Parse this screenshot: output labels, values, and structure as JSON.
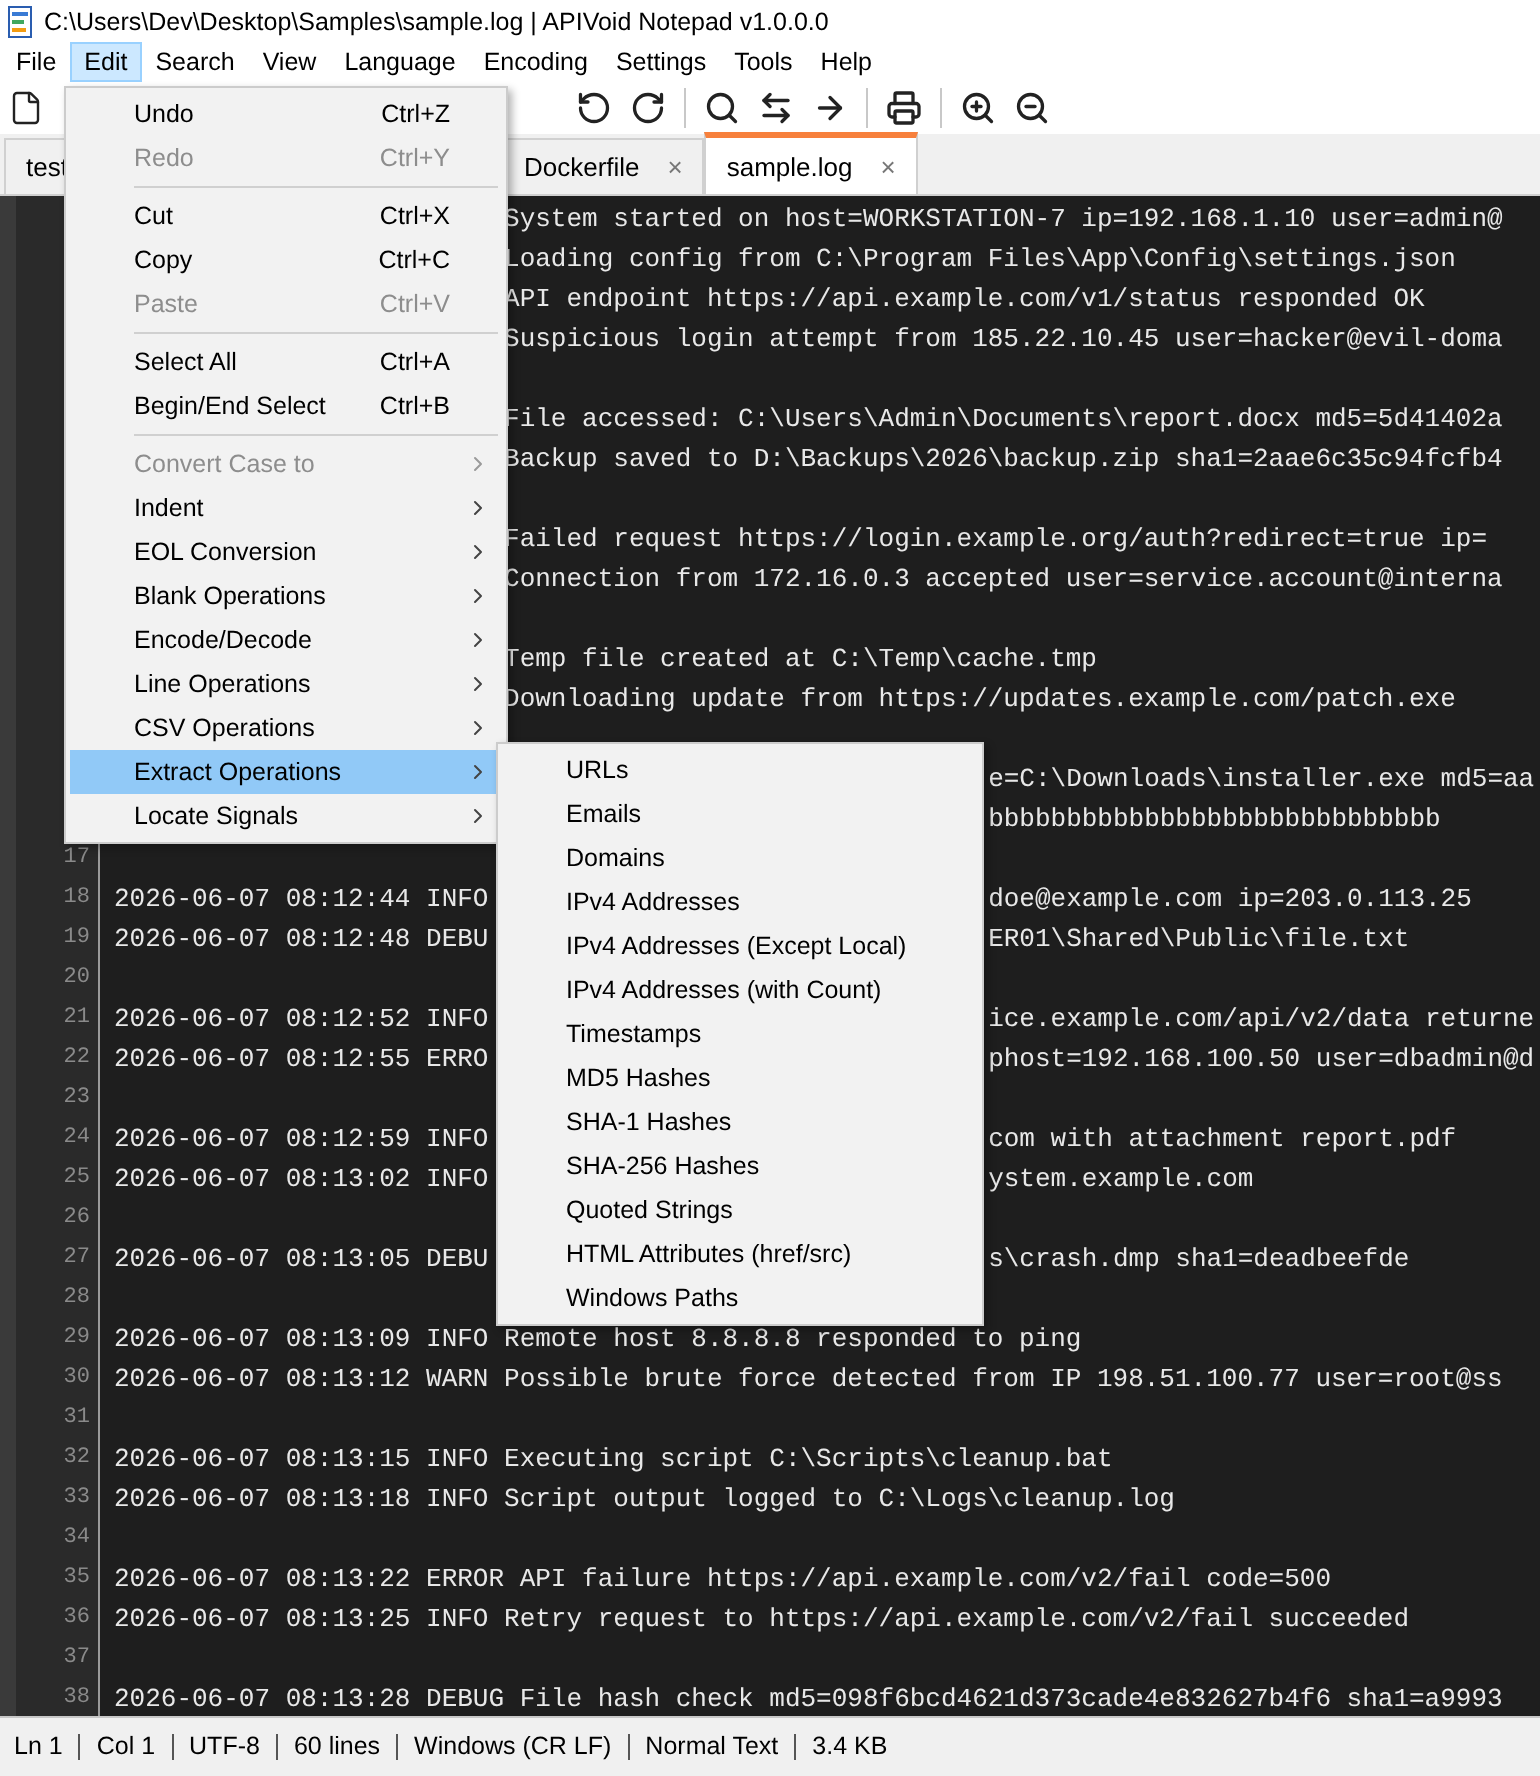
{
  "window": {
    "title": "C:\\Users\\Dev\\Desktop\\Samples\\sample.log | APIVoid Notepad v1.0.0.0"
  },
  "menubar": [
    {
      "label": "File",
      "selected": false
    },
    {
      "label": "Edit",
      "selected": true
    },
    {
      "label": "Search",
      "selected": false
    },
    {
      "label": "View",
      "selected": false
    },
    {
      "label": "Language",
      "selected": false
    },
    {
      "label": "Encoding",
      "selected": false
    },
    {
      "label": "Settings",
      "selected": false
    },
    {
      "label": "Tools",
      "selected": false
    },
    {
      "label": "Help",
      "selected": false
    }
  ],
  "tabs": [
    {
      "label": "test",
      "selected": false
    },
    {
      "label": "Dockerfile",
      "close": "×",
      "selected": false
    },
    {
      "label": "sample.log",
      "close": "×",
      "selected": true
    }
  ],
  "editor": {
    "lines": [
      {
        "kind": "under-menu",
        "tail": "System started on host=WORKSTATION-7 ip=192.168.1.10 user=admin@"
      },
      {
        "kind": "under-menu",
        "tail": "Loading config from C:\\Program Files\\App\\Config\\settings.json"
      },
      {
        "kind": "under-menu",
        "tail": "API endpoint https://api.example.com/v1/status responded OK"
      },
      {
        "kind": "under-menu",
        "tail": "Suspicious login attempt from 185.22.10.45 user=hacker@evil-doma"
      },
      {
        "kind": "under-menu"
      },
      {
        "kind": "under-menu",
        "tail": "File accessed: C:\\Users\\Admin\\Documents\\report.docx md5=5d41402a"
      },
      {
        "kind": "under-menu",
        "tail": "Backup saved to D:\\Backups\\2026\\backup.zip sha1=2aae6c35c94fcfb4"
      },
      {
        "kind": "under-menu"
      },
      {
        "kind": "under-menu",
        "tail": "Failed request https://login.example.org/auth?redirect=true ip="
      },
      {
        "kind": "under-menu",
        "tail": "Connection from 172.16.0.3 accepted user=service.account@interna"
      },
      {
        "kind": "under-menu"
      },
      {
        "kind": "under-menu",
        "tail": "Temp file created at C:\\Temp\\cache.tmp"
      },
      {
        "kind": "under-menu",
        "tail": "Downloading update from https://updates.example.com/patch.exe"
      },
      {
        "kind": "under-menu"
      },
      {
        "kind": "under-submenu",
        "tail": "e=C:\\Downloads\\installer.exe md5=aa"
      },
      {
        "kind": "under-submenu",
        "tail": "bbbbbbbbbbbbbbbbbbbbbbbbbbbbb"
      },
      {
        "kind": "plain",
        "number": "17"
      },
      {
        "kind": "under-submenu",
        "number": "18",
        "text": "2026-06-07 08:12:44 INFO",
        "tail": "doe@example.com ip=203.0.113.25"
      },
      {
        "kind": "under-submenu",
        "number": "19",
        "text": "2026-06-07 08:12:48 DEBU",
        "tail": "ER01\\Shared\\Public\\file.txt"
      },
      {
        "kind": "plain",
        "number": "20"
      },
      {
        "kind": "under-submenu",
        "number": "21",
        "text": "2026-06-07 08:12:52 INFO",
        "tail": "ice.example.com/api/v2/data returne"
      },
      {
        "kind": "under-submenu",
        "number": "22",
        "text": "2026-06-07 08:12:55 ERRO",
        "tail": "phost=192.168.100.50 user=dbadmin@d"
      },
      {
        "kind": "plain",
        "number": "23"
      },
      {
        "kind": "under-submenu",
        "number": "24",
        "text": "2026-06-07 08:12:59 INFO",
        "tail": "com with attachment report.pdf"
      },
      {
        "kind": "under-submenu",
        "number": "25",
        "text": "2026-06-07 08:13:02 INFO",
        "tail": "ystem.example.com"
      },
      {
        "kind": "plain",
        "number": "26"
      },
      {
        "kind": "under-submenu",
        "number": "27",
        "text": "2026-06-07 08:13:05 DEBU",
        "tail": "s\\crash.dmp sha1=deadbeefde"
      },
      {
        "kind": "plain",
        "number": "28"
      },
      {
        "kind": "plain",
        "number": "29",
        "text": "2026-06-07 08:13:09 INFO Remote host 8.8.8.8 responded to ping"
      },
      {
        "kind": "plain",
        "number": "30",
        "text": "2026-06-07 08:13:12 WARN Possible brute force detected from IP 198.51.100.77 user=root@ss"
      },
      {
        "kind": "plain",
        "number": "31"
      },
      {
        "kind": "plain",
        "number": "32",
        "text": "2026-06-07 08:13:15 INFO Executing script C:\\Scripts\\cleanup.bat"
      },
      {
        "kind": "plain",
        "number": "33",
        "text": "2026-06-07 08:13:18 INFO Script output logged to C:\\Logs\\cleanup.log"
      },
      {
        "kind": "plain",
        "number": "34"
      },
      {
        "kind": "plain",
        "number": "35",
        "text": "2026-06-07 08:13:22 ERROR API failure https://api.example.com/v2/fail code=500"
      },
      {
        "kind": "plain",
        "number": "36",
        "text": "2026-06-07 08:13:25 INFO Retry request to https://api.example.com/v2/fail succeeded"
      },
      {
        "kind": "plain",
        "number": "37"
      },
      {
        "kind": "plain",
        "number": "38",
        "text": "2026-06-07 08:13:28 DEBUG File hash check md5=098f6bcd4621d373cade4e832627b4f6 sha1=a9993"
      }
    ]
  },
  "edit_menu": {
    "items": [
      {
        "kind": "item",
        "label": "Undo",
        "shortcut": "Ctrl+Z",
        "disabled": false,
        "submenu": false,
        "selected": false
      },
      {
        "kind": "item",
        "label": "Redo",
        "shortcut": "Ctrl+Y",
        "disabled": true,
        "submenu": false,
        "selected": false
      },
      {
        "kind": "separator"
      },
      {
        "kind": "item",
        "label": "Cut",
        "shortcut": "Ctrl+X",
        "disabled": false,
        "submenu": false,
        "selected": false
      },
      {
        "kind": "item",
        "label": "Copy",
        "shortcut": "Ctrl+C",
        "disabled": false,
        "submenu": false,
        "selected": false
      },
      {
        "kind": "item",
        "label": "Paste",
        "shortcut": "Ctrl+V",
        "disabled": true,
        "submenu": false,
        "selected": false
      },
      {
        "kind": "separator"
      },
      {
        "kind": "item",
        "label": "Select All",
        "shortcut": "Ctrl+A",
        "disabled": false,
        "submenu": false,
        "selected": false
      },
      {
        "kind": "item",
        "label": "Begin/End Select",
        "shortcut": "Ctrl+B",
        "disabled": false,
        "submenu": false,
        "selected": false
      },
      {
        "kind": "separator"
      },
      {
        "kind": "item",
        "label": "Convert Case to",
        "disabled": true,
        "submenu": true,
        "selected": false
      },
      {
        "kind": "item",
        "label": "Indent",
        "disabled": false,
        "submenu": true,
        "selected": false
      },
      {
        "kind": "item",
        "label": "EOL Conversion",
        "disabled": false,
        "submenu": true,
        "selected": false
      },
      {
        "kind": "item",
        "label": "Blank Operations",
        "disabled": false,
        "submenu": true,
        "selected": false
      },
      {
        "kind": "item",
        "label": "Encode/Decode",
        "disabled": false,
        "submenu": true,
        "selected": false
      },
      {
        "kind": "item",
        "label": "Line Operations",
        "disabled": false,
        "submenu": true,
        "selected": false
      },
      {
        "kind": "item",
        "label": "CSV Operations",
        "disabled": false,
        "submenu": true,
        "selected": false
      },
      {
        "kind": "item",
        "label": "Extract Operations",
        "disabled": false,
        "submenu": true,
        "selected": true
      },
      {
        "kind": "item",
        "label": "Locate Signals",
        "disabled": false,
        "submenu": true,
        "selected": false
      }
    ]
  },
  "extract_submenu": {
    "items": [
      "URLs",
      "Emails",
      "Domains",
      "IPv4 Addresses",
      "IPv4 Addresses (Except Local)",
      "IPv4 Addresses (with Count)",
      "Timestamps",
      "MD5 Hashes",
      "SHA-1 Hashes",
      "SHA-256 Hashes",
      "Quoted Strings",
      "HTML Attributes (href/src)",
      "Windows Paths"
    ]
  },
  "status_bar": [
    "Ln 1",
    "Col 1",
    "UTF-8",
    "60 lines",
    "Windows (CR LF)",
    "Normal Text",
    "3.4 KB"
  ]
}
